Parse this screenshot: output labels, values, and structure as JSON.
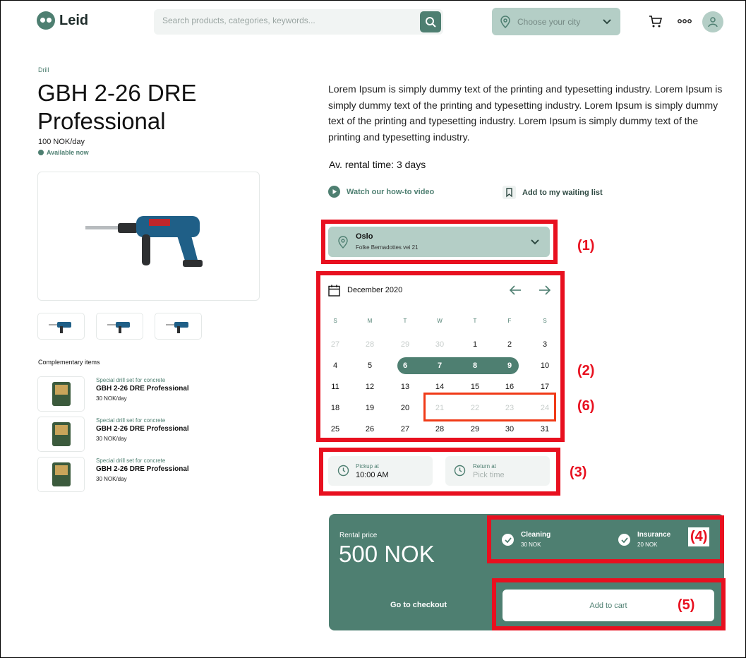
{
  "brand": {
    "name": "Leid",
    "color": "#4e7f71",
    "accent_light": "#b4cec6"
  },
  "header": {
    "search_placeholder": "Search products, categories, keywords...",
    "city_placeholder": "Choose your city",
    "icons": [
      "search-icon",
      "location-pin-icon",
      "chevron-down-icon",
      "cart-icon",
      "more-icon",
      "user-icon"
    ]
  },
  "product": {
    "category": "Drill",
    "title": "GBH 2-26 DRE Professional",
    "price": "100 NOK/day",
    "availability": "Available now",
    "description": "Lorem Ipsum is simply dummy text of the printing and typesetting industry. Lorem Ipsum is simply dummy text of the printing and typesetting industry.  Lorem Ipsum is simply dummy text of the printing and typesetting industry.  Lorem Ipsum is simply dummy text of the printing and typesetting industry.",
    "avg_rental": "Av. rental time: 3 days"
  },
  "links": {
    "video": "Watch our how-to video",
    "waiting_list": "Add to my waiting list"
  },
  "complementary": {
    "title": "Complementary items",
    "items": [
      {
        "tag": "Special drill set for concrete",
        "name": "GBH 2-26 DRE Professional",
        "price": "30 NOK/day"
      },
      {
        "tag": "Special drill set for concrete",
        "name": "GBH 2-26 DRE Professional",
        "price": "30 NOK/day"
      },
      {
        "tag": "Special drill set for concrete",
        "name": "GBH 2-26 DRE Professional",
        "price": "30 NOK/day"
      }
    ]
  },
  "location": {
    "city": "Oslo",
    "address": "Folke Bernadottes vei 21"
  },
  "calendar": {
    "month": "December 2020",
    "weekdays": [
      "S",
      "M",
      "T",
      "W",
      "T",
      "F",
      "S"
    ],
    "weeks": [
      [
        "27",
        "28",
        "29",
        "30",
        "1",
        "2",
        "3"
      ],
      [
        "4",
        "5",
        "6",
        "7",
        "8",
        "9",
        "10"
      ],
      [
        "11",
        "12",
        "13",
        "14",
        "15",
        "16",
        "17"
      ],
      [
        "18",
        "19",
        "20",
        "21",
        "22",
        "23",
        "24"
      ],
      [
        "25",
        "26",
        "27",
        "28",
        "29",
        "30",
        "31"
      ]
    ],
    "muted_days": [
      "27",
      "28",
      "29",
      "30",
      "21",
      "22",
      "23",
      "24"
    ],
    "selected_range": [
      "6",
      "7",
      "8",
      "9"
    ]
  },
  "times": {
    "pickup_label": "Pickup at",
    "pickup_value": "10:00 AM",
    "return_label": "Return at",
    "return_placeholder": "Pick time"
  },
  "checkout": {
    "rental_label": "Rental price",
    "rental_value": "500 NOK",
    "options": [
      {
        "name": "Cleaning",
        "price": "30 NOK"
      },
      {
        "name": "Insurance",
        "price": "20 NOK"
      }
    ],
    "go_to_checkout": "Go to checkout",
    "add_to_cart": "Add to cart"
  },
  "annotations": [
    "(1)",
    "(2)",
    "(3)",
    "(4)",
    "(5)",
    "(6)"
  ]
}
